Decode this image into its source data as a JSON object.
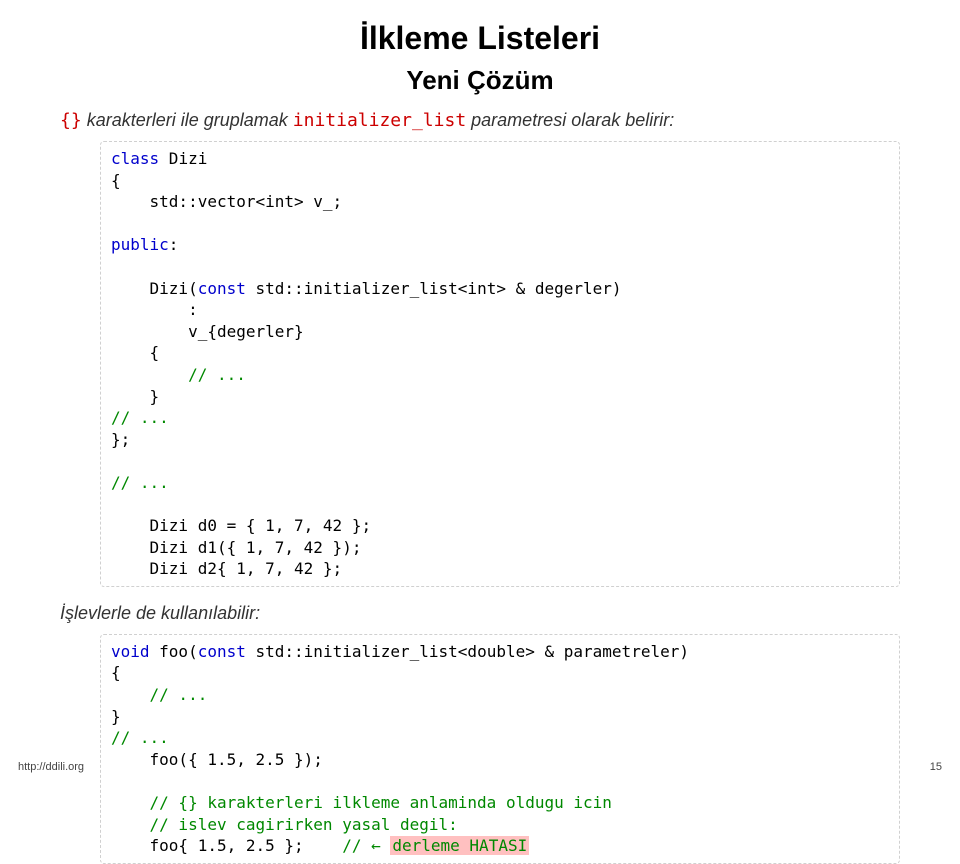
{
  "title": "İlkleme Listeleri",
  "subtitle": "Yeni Çözüm",
  "intro": {
    "mono1": "{}",
    "text1": " karakterleri ile gruplamak ",
    "mono2": "initializer_list",
    "text2": " parametresi olarak belirir:"
  },
  "code1": {
    "l1_kw": "class",
    "l1_rest": " Dizi",
    "l2": "{",
    "l3": "    std::vector<int> v_;",
    "l4_blank": "",
    "l5_kw": "public",
    "l5_rest": ":",
    "l6_blank": "",
    "l7a": "    Dizi(",
    "l7_kw": "const",
    "l7b": " std::initializer_list<int> & degerler)",
    "l8": "        :",
    "l9": "        v_{degerler}",
    "l10": "    {",
    "l11a": "        ",
    "l11_cm": "// ...",
    "l12": "    }",
    "l13_cm": "// ...",
    "l14": "};",
    "l15_blank": "",
    "l16_cm": "// ...",
    "l17_blank": "",
    "l18": "    Dizi d0 = { 1, 7, 42 };",
    "l19": "    Dizi d1({ 1, 7, 42 });",
    "l20": "    Dizi d2{ 1, 7, 42 };"
  },
  "midtext": "İşlevlerle de kullanılabilir:",
  "code2": {
    "l1_kw1": "void",
    "l1a": " foo(",
    "l1_kw2": "const",
    "l1b": " std::initializer_list<double> & parametreler)",
    "l2": "{",
    "l3a": "    ",
    "l3_cm": "// ...",
    "l4": "}",
    "l5_cm": "// ...",
    "l6": "    foo({ 1.5, 2.5 });",
    "l7_blank": "",
    "l8a": "    ",
    "l8_cm": "// {} karakterleri ilkleme anlaminda oldugu icin",
    "l9a": "    ",
    "l9_cm": "// islev cagirirken yasal degil:",
    "l10a": "    foo{ 1.5, 2.5 };    ",
    "l10_cm": "// ← ",
    "l10_err": "derleme HATASI"
  },
  "footer": {
    "left": "http://ddili.org",
    "right": "15"
  }
}
